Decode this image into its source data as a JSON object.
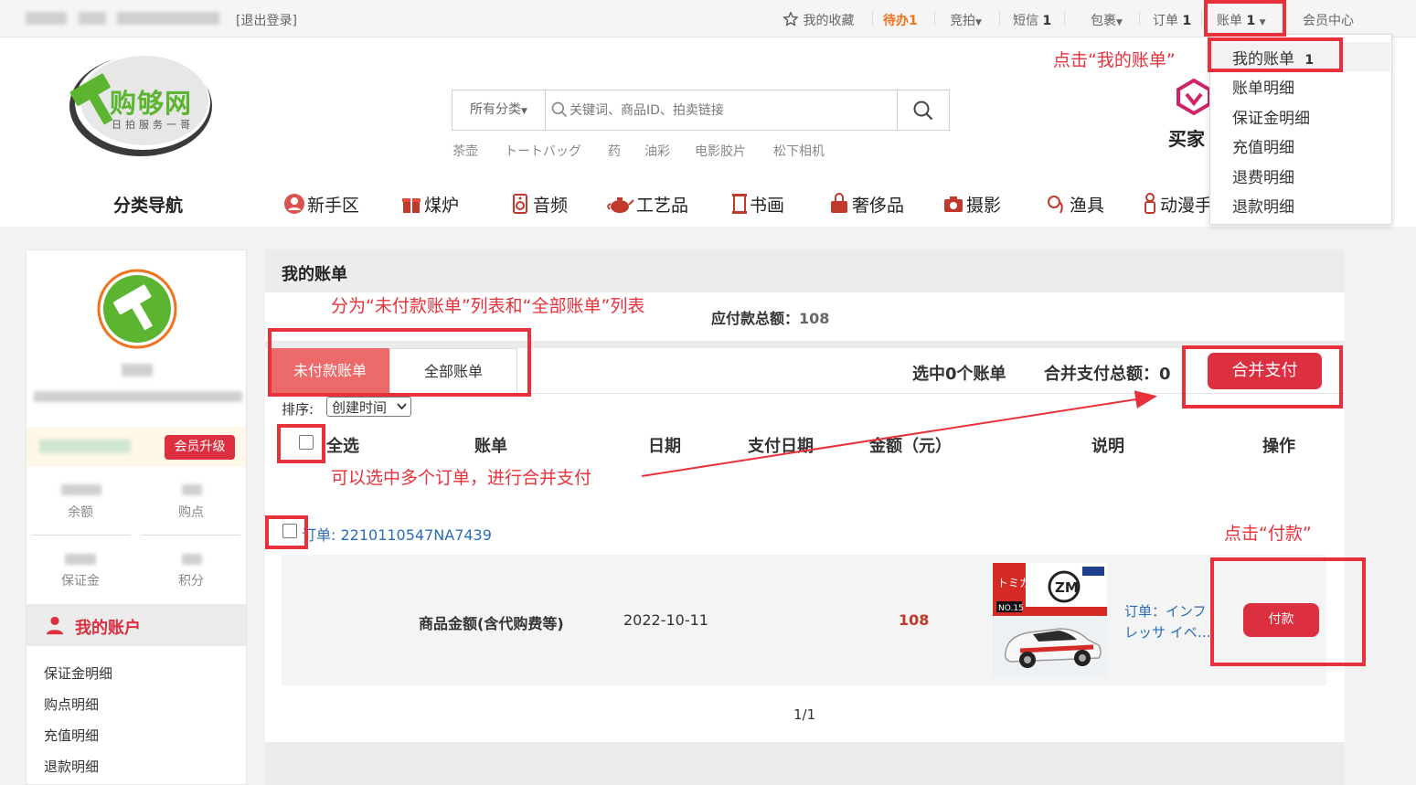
{
  "topbar": {
    "logout": "[退出登录]",
    "favorites": "我的收藏",
    "todo": "待办1",
    "bidding": "竞拍",
    "sms": "短信",
    "sms_count": "1",
    "package": "包裹",
    "orders": "订单",
    "orders_count": "1",
    "bills": "账单",
    "bills_count": "1",
    "member_center": "会员中心"
  },
  "bills_dropdown": {
    "items": [
      {
        "label": "我的账单",
        "badge": "1"
      },
      {
        "label": "账单明细"
      },
      {
        "label": "保证金明细"
      },
      {
        "label": "充值明细"
      },
      {
        "label": "退费明细"
      },
      {
        "label": "退款明细"
      }
    ]
  },
  "logo": {
    "title": "购够网",
    "slogan": "日拍服务一哥"
  },
  "search": {
    "category": "所有分类",
    "placeholder": "关键词、商品ID、拍卖链接",
    "hot_terms": [
      "茶壶",
      "トートバッグ",
      "药",
      "油彩",
      "电影胶片",
      "松下相机"
    ]
  },
  "buyer_partial": "买家",
  "category_nav": {
    "title": "分类导航",
    "items": [
      "新手区",
      "煤炉",
      "音频",
      "工艺品",
      "书画",
      "奢侈品",
      "摄影",
      "渔具",
      "动漫手"
    ]
  },
  "sidebar": {
    "upgrade": "会员升级",
    "stats": [
      "余额",
      "购点",
      "保证金",
      "积分"
    ],
    "account_title": "我的账户",
    "links": [
      "保证金明细",
      "购点明细",
      "充值明细",
      "退款明细"
    ]
  },
  "main": {
    "title": "我的账单",
    "total_due_label": "应付款总额：",
    "total_due_value": "108",
    "tabs": [
      "未付款账单",
      "全部账单"
    ],
    "selected_count": "选中0个账单",
    "merge_total": "合并支付总额：0",
    "merge_pay": "合并支付",
    "sort_label": "排序:",
    "sort_value": "创建时间",
    "columns": [
      "全选",
      "账单",
      "日期",
      "支付日期",
      "金额（元）",
      "说明",
      "操作"
    ],
    "order_no": "订单: 2210110547NA7439",
    "row": {
      "item": "商品金额(含代购费等)",
      "date": "2022-10-11",
      "amount": "108",
      "desc_line1": "订单：インフ",
      "desc_line2": "レッサ イベ…",
      "pay": "付款"
    },
    "pagination": "1/1"
  },
  "annotations": {
    "click_my_bill": "点击“我的账单”",
    "lists": "分为“未付款账单”列表和“全部账单”列表",
    "multi_select": "可以选中多个订单，进行合并支付",
    "click_pay": "点击“付款”"
  },
  "colors": {
    "accent": "#dc2f3f",
    "annotation": "#e8313b",
    "logo_green": "#5cb531"
  }
}
